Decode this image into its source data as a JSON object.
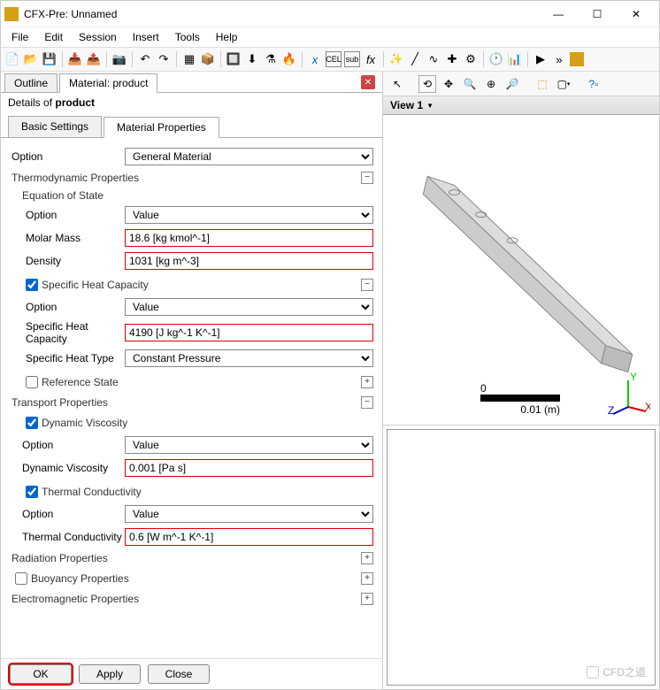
{
  "window": {
    "title": "CFX-Pre:  Unnamed"
  },
  "menu": [
    "File",
    "Edit",
    "Session",
    "Insert",
    "Tools",
    "Help"
  ],
  "tabs": {
    "outline": "Outline",
    "material": "Material: product"
  },
  "details": {
    "prefix": "Details of ",
    "name": "product"
  },
  "subtabs": {
    "basic": "Basic Settings",
    "matprop": "Material Properties"
  },
  "fields": {
    "option_label": "Option",
    "option_value": "General Material",
    "thermo_hdr": "Thermodynamic Properties",
    "eos_hdr": "Equation of State",
    "eos_option": "Value",
    "molar_mass_lbl": "Molar Mass",
    "molar_mass_val": "18.6 [kg kmol^-1]",
    "density_lbl": "Density",
    "density_val": "1031 [kg m^-3]",
    "shc_chk": "Specific Heat Capacity",
    "shc_option": "Value",
    "shc_lbl": "Specific Heat Capacity",
    "shc_val": "4190 [J kg^-1 K^-1]",
    "sht_lbl": "Specific Heat Type",
    "sht_val": "Constant Pressure",
    "refstate": "Reference State",
    "transport_hdr": "Transport Properties",
    "dynvisc_chk": "Dynamic Viscosity",
    "dynvisc_option": "Value",
    "dynvisc_lbl": "Dynamic Viscosity",
    "dynvisc_val": "0.001 [Pa s]",
    "thermcond_chk": "Thermal Conductivity",
    "thermcond_option": "Value",
    "thermcond_lbl": "Thermal Conductivity",
    "thermcond_val": "0.6 [W m^-1 K^-1]",
    "radiation": "Radiation Properties",
    "buoyancy": "Buoyancy Properties",
    "electro": "Electromagnetic Properties"
  },
  "buttons": {
    "ok": "OK",
    "apply": "Apply",
    "close": "Close"
  },
  "view": {
    "label": "View 1"
  },
  "scale": {
    "zero": "0",
    "val": "0.01 (m)"
  },
  "watermark": "CFD之道"
}
